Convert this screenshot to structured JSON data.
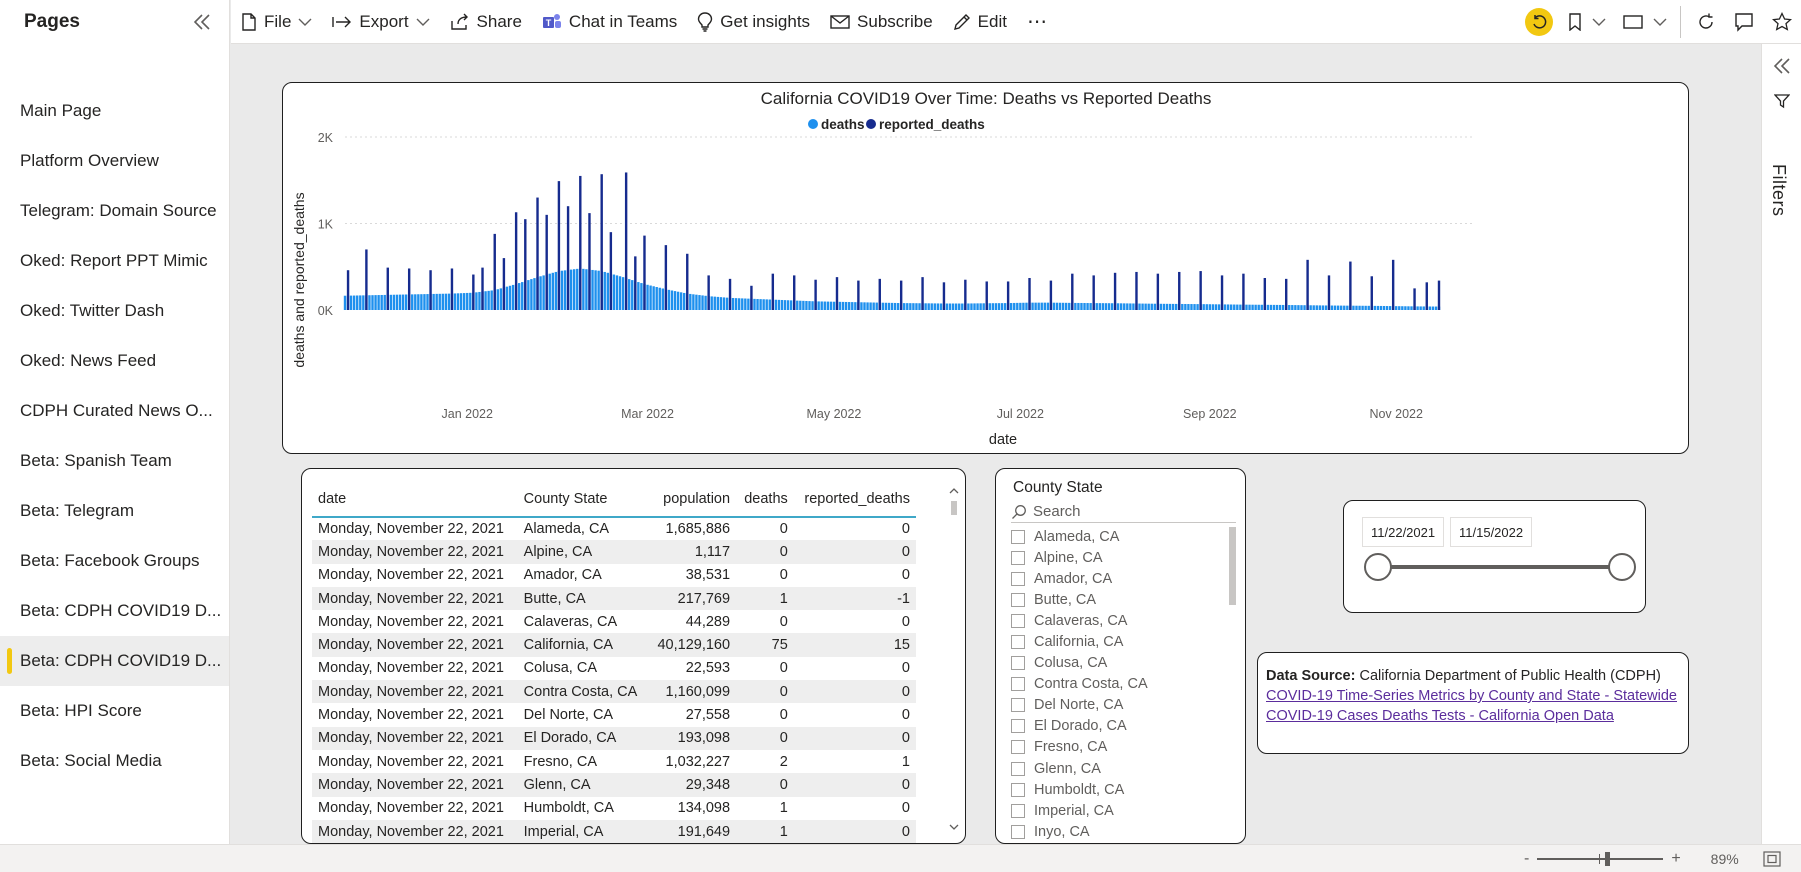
{
  "pages_panel": {
    "title": "Pages",
    "items": [
      {
        "label": "Main Page",
        "active": false
      },
      {
        "label": "Platform Overview",
        "active": false
      },
      {
        "label": "Telegram: Domain Source",
        "active": false
      },
      {
        "label": "Oked: Report PPT Mimic",
        "active": false
      },
      {
        "label": "Oked: Twitter Dash",
        "active": false
      },
      {
        "label": "Oked: News Feed",
        "active": false
      },
      {
        "label": "CDPH Curated News O...",
        "active": false
      },
      {
        "label": "Beta: Spanish Team",
        "active": false
      },
      {
        "label": "Beta: Telegram",
        "active": false
      },
      {
        "label": "Beta: Facebook Groups",
        "active": false
      },
      {
        "label": "Beta: CDPH COVID19 D...",
        "active": false
      },
      {
        "label": "Beta: CDPH COVID19 D...",
        "active": true
      },
      {
        "label": "Beta: HPI Score",
        "active": false
      },
      {
        "label": "Beta: Social Media",
        "active": false
      }
    ]
  },
  "toolbar": {
    "file": "File",
    "export": "Export",
    "share": "Share",
    "chat": "Chat in Teams",
    "insights": "Get insights",
    "subscribe": "Subscribe",
    "edit": "Edit",
    "more": "⋯"
  },
  "filters_pane": {
    "label": "Filters"
  },
  "status_bar": {
    "zoom": "89%"
  },
  "colors": {
    "deaths": "#1e90ee",
    "reported_deaths": "#162b8e",
    "accent": "#f2c811",
    "table_header_rule": "#3fa8c8",
    "link": "#5b2d9c"
  },
  "chart_data": {
    "type": "bar",
    "title": "California COVID19 Over Time: Deaths vs Reported Deaths",
    "xlabel": "date",
    "ylabel": "deaths and reported_deaths",
    "ylim": [
      0,
      2000
    ],
    "yticks": [
      "0K",
      "1K",
      "2K"
    ],
    "xticks": [
      "Jan 2022",
      "Mar 2022",
      "May 2022",
      "Jul 2022",
      "Sep 2022",
      "Nov 2022"
    ],
    "x_range": [
      "2021-11-22",
      "2022-11-15"
    ],
    "legend_position": "top-center",
    "gridlines": true,
    "series": [
      {
        "name": "deaths",
        "description": "daily deaths, approximate weekly averages",
        "weekly_values": [
          165,
          170,
          175,
          180,
          185,
          190,
          200,
          230,
          300,
          380,
          450,
          480,
          450,
          380,
          300,
          240,
          190,
          160,
          140,
          130,
          120,
          110,
          100,
          95,
          90,
          85,
          80,
          78,
          75,
          75,
          78,
          80,
          85,
          85,
          82,
          80,
          78,
          75,
          72,
          70,
          68,
          65,
          62,
          60,
          58,
          55,
          52,
          50,
          48,
          45,
          42,
          40,
          38
        ]
      },
      {
        "name": "reported_deaths",
        "description": "spikes on reporting days, approximate",
        "points": [
          {
            "date": "2021-11-23",
            "value": 460
          },
          {
            "date": "2021-11-29",
            "value": 700
          },
          {
            "date": "2021-12-06",
            "value": 490
          },
          {
            "date": "2021-12-13",
            "value": 480
          },
          {
            "date": "2021-12-20",
            "value": 460
          },
          {
            "date": "2021-12-27",
            "value": 480
          },
          {
            "date": "2022-01-03",
            "value": 410
          },
          {
            "date": "2022-01-06",
            "value": 490
          },
          {
            "date": "2022-01-10",
            "value": 880
          },
          {
            "date": "2022-01-13",
            "value": 600
          },
          {
            "date": "2022-01-17",
            "value": 1130
          },
          {
            "date": "2022-01-20",
            "value": 1050
          },
          {
            "date": "2022-01-24",
            "value": 1300
          },
          {
            "date": "2022-01-27",
            "value": 1100
          },
          {
            "date": "2022-01-31",
            "value": 1490
          },
          {
            "date": "2022-02-03",
            "value": 1200
          },
          {
            "date": "2022-02-07",
            "value": 1550
          },
          {
            "date": "2022-02-10",
            "value": 1120
          },
          {
            "date": "2022-02-14",
            "value": 1570
          },
          {
            "date": "2022-02-17",
            "value": 900
          },
          {
            "date": "2022-02-22",
            "value": 1590
          },
          {
            "date": "2022-02-25",
            "value": 620
          },
          {
            "date": "2022-02-28",
            "value": 860
          },
          {
            "date": "2022-03-07",
            "value": 750
          },
          {
            "date": "2022-03-14",
            "value": 650
          },
          {
            "date": "2022-03-21",
            "value": 400
          },
          {
            "date": "2022-03-28",
            "value": 360
          },
          {
            "date": "2022-04-04",
            "value": 280
          },
          {
            "date": "2022-04-11",
            "value": 420
          },
          {
            "date": "2022-04-18",
            "value": 400
          },
          {
            "date": "2022-04-25",
            "value": 350
          },
          {
            "date": "2022-05-02",
            "value": 380
          },
          {
            "date": "2022-05-09",
            "value": 340
          },
          {
            "date": "2022-05-16",
            "value": 360
          },
          {
            "date": "2022-05-23",
            "value": 340
          },
          {
            "date": "2022-05-30",
            "value": 380
          },
          {
            "date": "2022-06-06",
            "value": 320
          },
          {
            "date": "2022-06-13",
            "value": 350
          },
          {
            "date": "2022-06-20",
            "value": 330
          },
          {
            "date": "2022-06-27",
            "value": 330
          },
          {
            "date": "2022-07-04",
            "value": 370
          },
          {
            "date": "2022-07-11",
            "value": 340
          },
          {
            "date": "2022-07-18",
            "value": 420
          },
          {
            "date": "2022-07-25",
            "value": 400
          },
          {
            "date": "2022-08-01",
            "value": 430
          },
          {
            "date": "2022-08-08",
            "value": 440
          },
          {
            "date": "2022-08-15",
            "value": 420
          },
          {
            "date": "2022-08-22",
            "value": 440
          },
          {
            "date": "2022-08-29",
            "value": 450
          },
          {
            "date": "2022-09-05",
            "value": 400
          },
          {
            "date": "2022-09-12",
            "value": 420
          },
          {
            "date": "2022-09-19",
            "value": 370
          },
          {
            "date": "2022-09-26",
            "value": 360
          },
          {
            "date": "2022-10-03",
            "value": 580
          },
          {
            "date": "2022-10-10",
            "value": 400
          },
          {
            "date": "2022-10-17",
            "value": 560
          },
          {
            "date": "2022-10-24",
            "value": 390
          },
          {
            "date": "2022-10-31",
            "value": 580
          },
          {
            "date": "2022-11-07",
            "value": 250
          },
          {
            "date": "2022-11-11",
            "value": 320
          },
          {
            "date": "2022-11-15",
            "value": 340
          }
        ]
      }
    ]
  },
  "table": {
    "columns": [
      "date",
      "County State",
      "population",
      "deaths",
      "reported_deaths"
    ],
    "rows": [
      [
        "Monday, November 22, 2021",
        "Alameda, CA",
        "1,685,886",
        "0",
        "0"
      ],
      [
        "Monday, November 22, 2021",
        "Alpine, CA",
        "1,117",
        "0",
        "0"
      ],
      [
        "Monday, November 22, 2021",
        "Amador, CA",
        "38,531",
        "0",
        "0"
      ],
      [
        "Monday, November 22, 2021",
        "Butte, CA",
        "217,769",
        "1",
        "-1"
      ],
      [
        "Monday, November 22, 2021",
        "Calaveras, CA",
        "44,289",
        "0",
        "0"
      ],
      [
        "Monday, November 22, 2021",
        "California, CA",
        "40,129,160",
        "75",
        "15"
      ],
      [
        "Monday, November 22, 2021",
        "Colusa, CA",
        "22,593",
        "0",
        "0"
      ],
      [
        "Monday, November 22, 2021",
        "Contra Costa, CA",
        "1,160,099",
        "0",
        "0"
      ],
      [
        "Monday, November 22, 2021",
        "Del Norte, CA",
        "27,558",
        "0",
        "0"
      ],
      [
        "Monday, November 22, 2021",
        "El Dorado, CA",
        "193,098",
        "0",
        "0"
      ],
      [
        "Monday, November 22, 2021",
        "Fresno, CA",
        "1,032,227",
        "2",
        "1"
      ],
      [
        "Monday, November 22, 2021",
        "Glenn, CA",
        "29,348",
        "0",
        "0"
      ],
      [
        "Monday, November 22, 2021",
        "Humboldt, CA",
        "134,098",
        "1",
        "0"
      ],
      [
        "Monday, November 22, 2021",
        "Imperial, CA",
        "191,649",
        "1",
        "0"
      ]
    ]
  },
  "slicer": {
    "title": "County State",
    "search_placeholder": "Search",
    "items": [
      "Alameda, CA",
      "Alpine, CA",
      "Amador, CA",
      "Butte, CA",
      "Calaveras, CA",
      "California, CA",
      "Colusa, CA",
      "Contra Costa, CA",
      "Del Norte, CA",
      "El Dorado, CA",
      "Fresno, CA",
      "Glenn, CA",
      "Humboldt, CA",
      "Imperial, CA",
      "Inyo, CA"
    ]
  },
  "date_slicer": {
    "start": "11/22/2021",
    "end": "11/15/2022"
  },
  "data_source": {
    "label": "Data Source:",
    "text": "California Department of Public Health (CDPH)",
    "link1": "COVID-19 Time-Series Metrics by County and State - Statewide",
    "link2": "COVID-19 Cases Deaths Tests - California Open Data"
  }
}
